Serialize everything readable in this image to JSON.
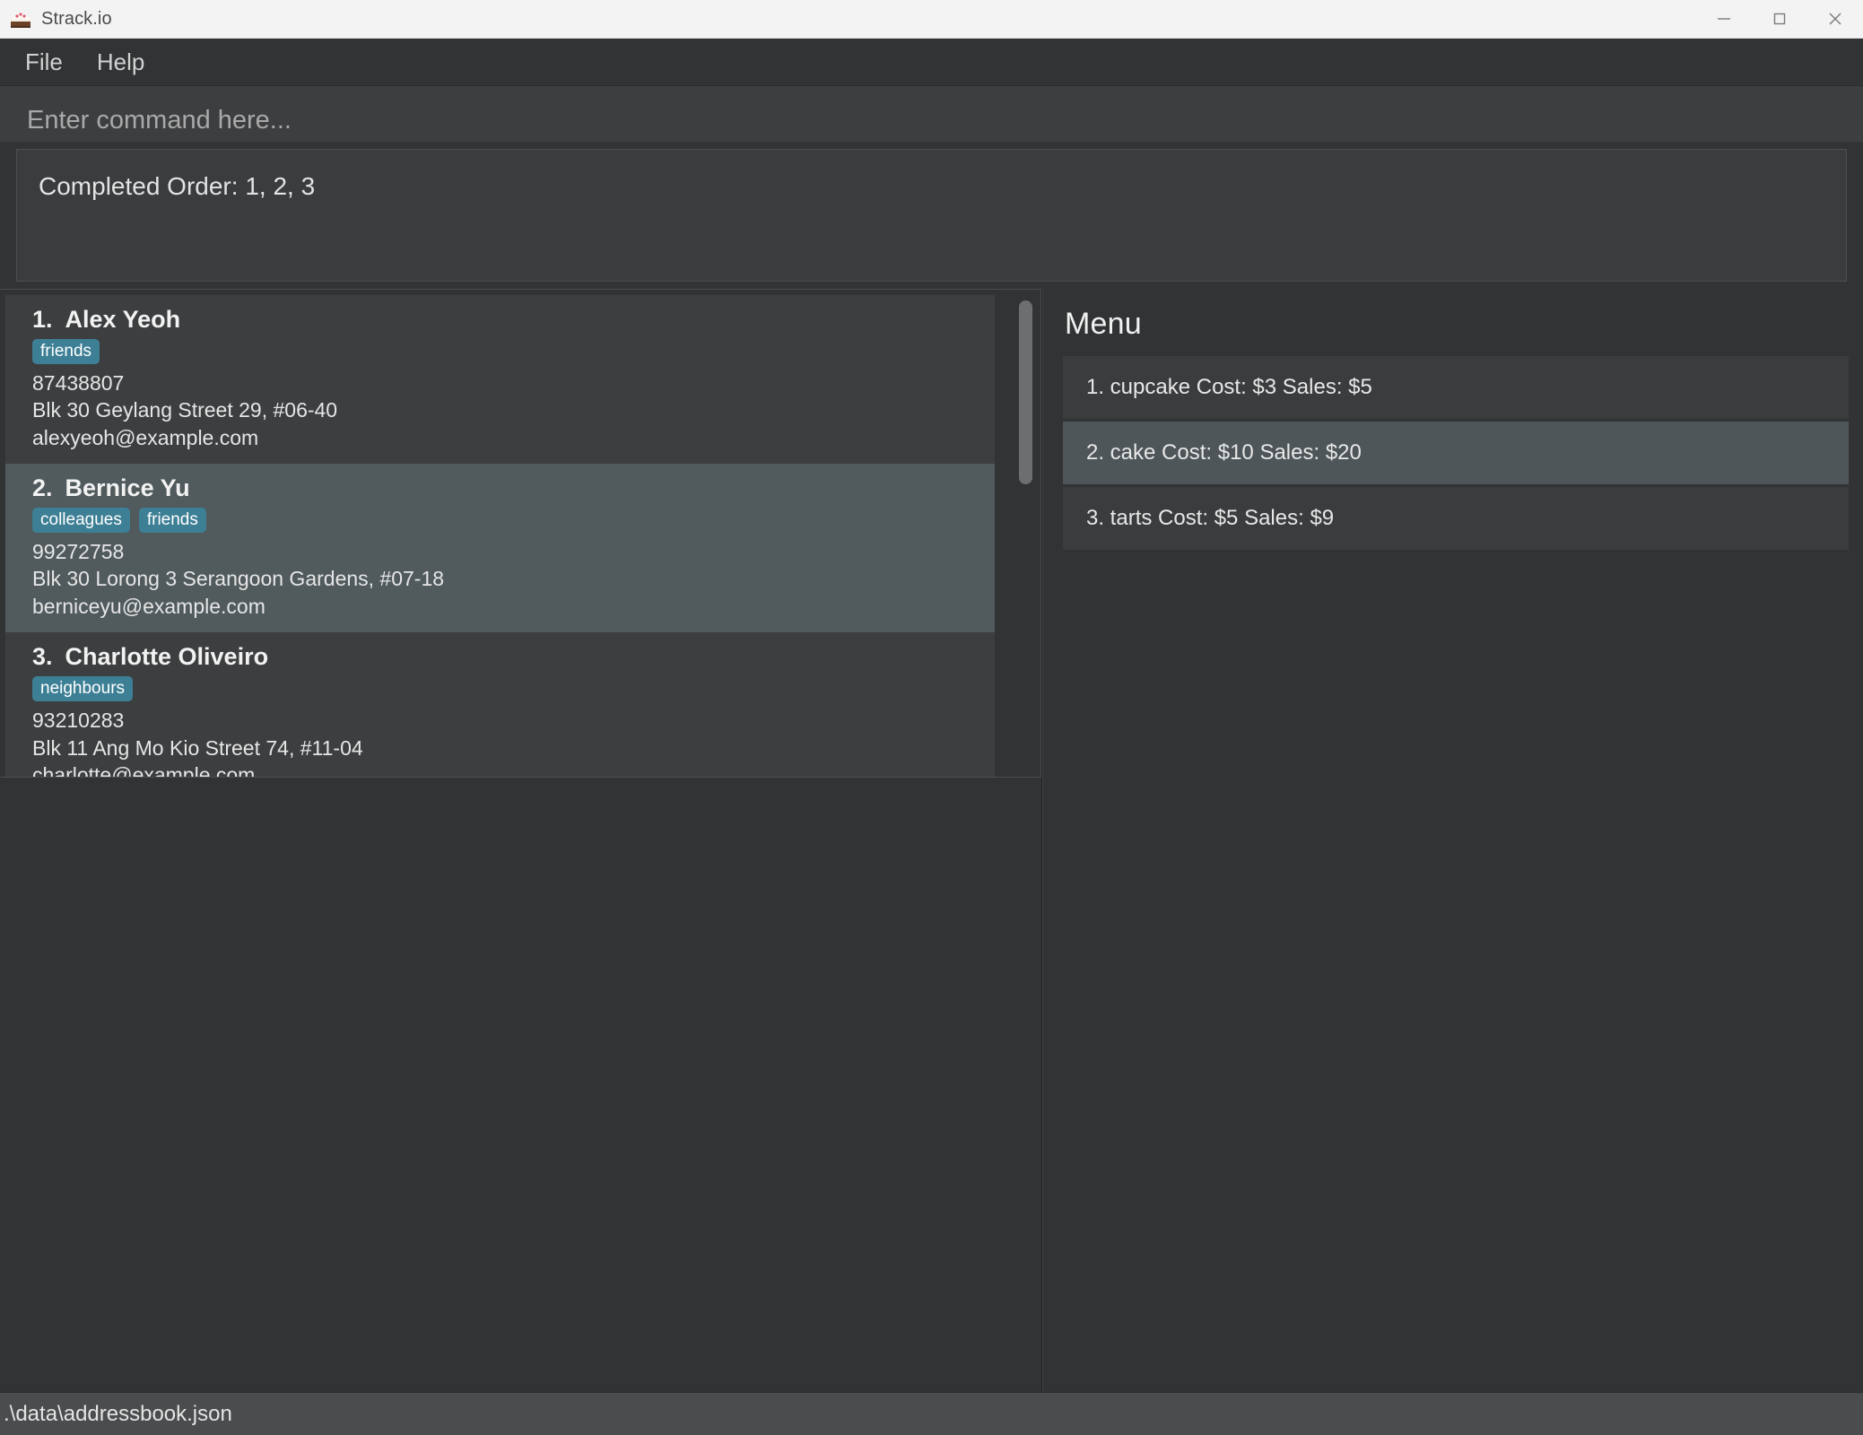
{
  "window": {
    "title": "Strack.io",
    "icon": "cake-icon",
    "controls": {
      "minimize": "minimize-icon",
      "maximize": "maximize-icon",
      "close": "close-icon"
    }
  },
  "menubar": {
    "items": [
      {
        "label": "File"
      },
      {
        "label": "Help"
      }
    ]
  },
  "command": {
    "placeholder": "Enter command here...",
    "value": ""
  },
  "result": {
    "text": "Completed Order: 1, 2, 3"
  },
  "persons": [
    {
      "index": "1.",
      "name": "Alex Yeoh",
      "tags": [
        "friends"
      ],
      "phone": "87438807",
      "address": "Blk 30 Geylang Street 29, #06-40",
      "email": "alexyeoh@example.com",
      "selected": false
    },
    {
      "index": "2.",
      "name": "Bernice Yu",
      "tags": [
        "colleagues",
        "friends"
      ],
      "phone": "99272758",
      "address": "Blk 30 Lorong 3 Serangoon Gardens, #07-18",
      "email": "berniceyu@example.com",
      "selected": true
    },
    {
      "index": "3.",
      "name": "Charlotte Oliveiro",
      "tags": [
        "neighbours"
      ],
      "phone": "93210283",
      "address": "Blk 11 Ang Mo Kio Street 74, #11-04",
      "email": "charlotte@example.com",
      "selected": false
    }
  ],
  "menu_panel": {
    "title": "Menu",
    "items": [
      {
        "text": "1. cupcake  Cost: $3  Sales: $5",
        "selected": false
      },
      {
        "text": "2. cake  Cost: $10  Sales: $20",
        "selected": true
      },
      {
        "text": "3. tarts  Cost: $5  Sales: $9",
        "selected": false
      }
    ]
  },
  "statusbar": {
    "path": ".\\data\\addressbook.json"
  },
  "colors": {
    "accent_tag": "#3d7f95",
    "selection": "#515a5d",
    "panel_bg": "#313335",
    "card_bg": "#3c3e40"
  }
}
